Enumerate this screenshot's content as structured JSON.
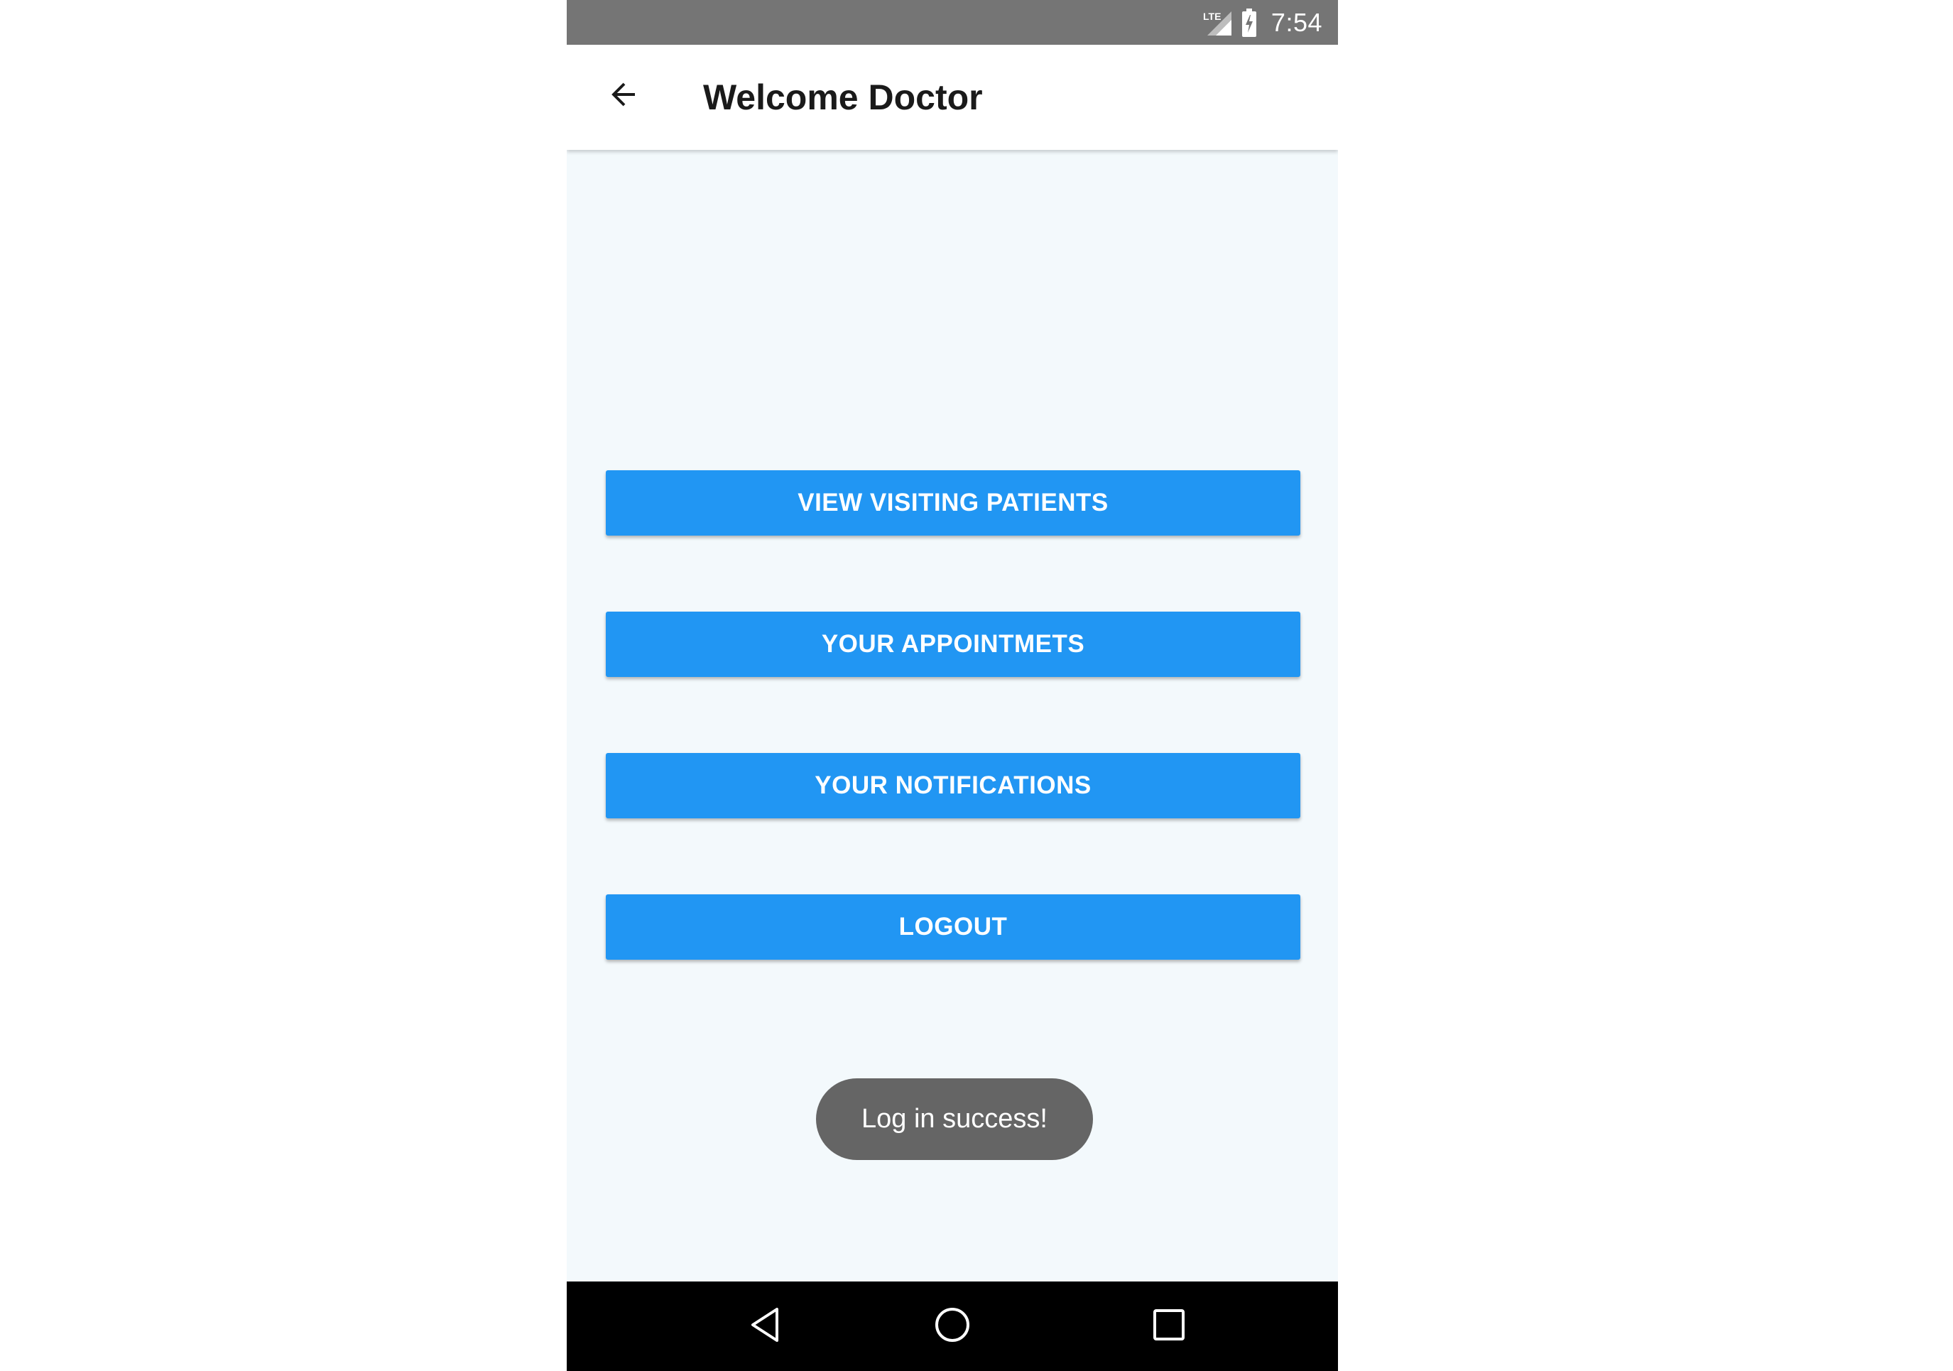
{
  "status_bar": {
    "network_label": "LTE",
    "time": "7:54",
    "icons": [
      "lte-signal-icon",
      "battery-charging-icon"
    ]
  },
  "app_bar": {
    "back_icon": "arrow-back-icon",
    "title": "Welcome Doctor"
  },
  "menu": {
    "buttons": [
      {
        "label": "VIEW VISITING PATIENTS"
      },
      {
        "label": "YOUR APPOINTMETS"
      },
      {
        "label": "YOUR NOTIFICATIONS"
      },
      {
        "label": "LOGOUT"
      }
    ]
  },
  "toast": {
    "message": "Log in success!"
  },
  "nav_bar": {
    "icons": [
      "nav-back-icon",
      "nav-home-icon",
      "nav-recents-icon"
    ]
  },
  "colors": {
    "status_bar": "#757575",
    "app_bar": "#ffffff",
    "background": "#f3f9fc",
    "button": "#2196f3",
    "button_text": "#ffffff",
    "toast": "#656565",
    "nav_bar": "#000000"
  }
}
